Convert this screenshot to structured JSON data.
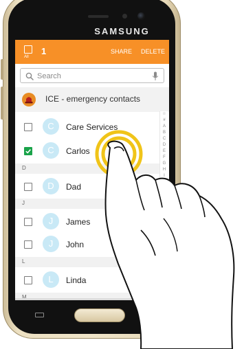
{
  "device": {
    "brand": "SAMSUNG"
  },
  "action_bar": {
    "all_label": "All",
    "selected_count": "1",
    "share_label": "SHARE",
    "delete_label": "DELETE",
    "color": "#f79027"
  },
  "search": {
    "placeholder": "Search"
  },
  "ice": {
    "label": "ICE - emergency contacts"
  },
  "sections": [
    {
      "letter": "D"
    },
    {
      "letter": "J"
    },
    {
      "letter": "L"
    },
    {
      "letter": "M"
    }
  ],
  "contacts": [
    {
      "initial": "C",
      "name": "Care Services",
      "checked": false
    },
    {
      "initial": "C",
      "name": "Carlos",
      "checked": true
    },
    {
      "initial": "D",
      "name": "Dad",
      "checked": false
    },
    {
      "initial": "J",
      "name": "James",
      "checked": false
    },
    {
      "initial": "J",
      "name": "John",
      "checked": false
    },
    {
      "initial": "L",
      "name": "Linda",
      "checked": false
    }
  ],
  "index_letters": [
    "☆",
    "#",
    "A",
    "B",
    "C",
    "D",
    "E",
    "F",
    "G",
    "H",
    "I",
    "J",
    "K",
    "L",
    "M",
    "N",
    "O"
  ],
  "colors": {
    "checkbox_checked": "#1aa34a",
    "avatar": "#c9e9f6",
    "touch_ring": "#f0c419"
  }
}
